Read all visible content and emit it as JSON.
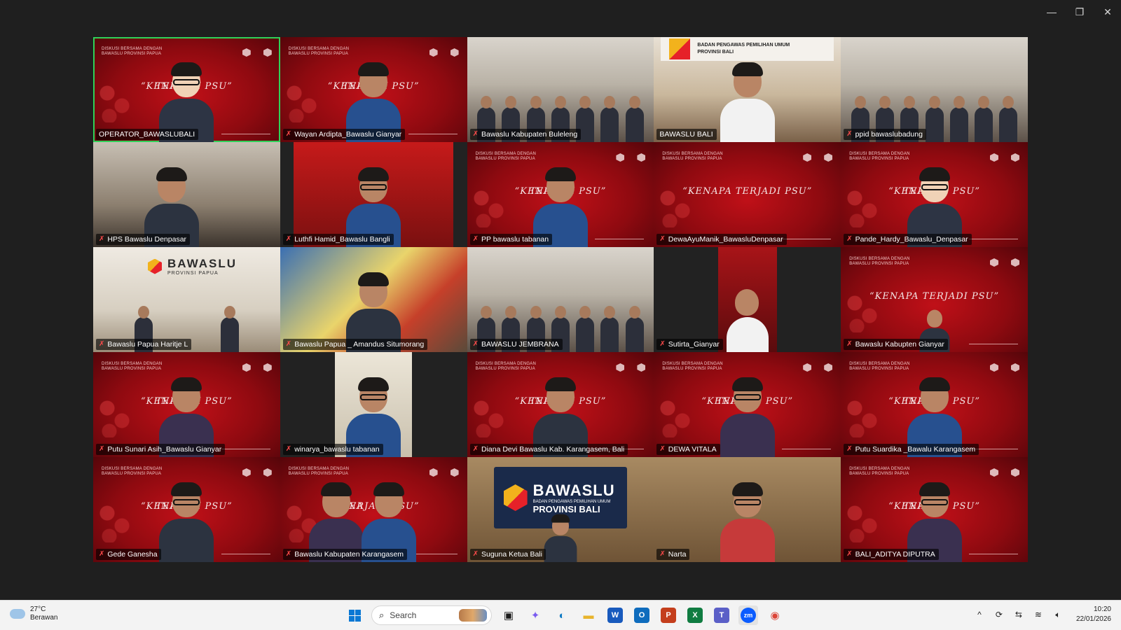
{
  "window": {
    "minimize": "—",
    "restore": "❐",
    "close": "✕"
  },
  "slide": {
    "header": "DISKUSI BERSAMA DENGAN BAWASLU PROVINSI PAPUA",
    "slogan_full": "“KENAPA TERJADI PSU”",
    "slogan_left": "“KENA",
    "slogan_right": "TERJADI PSU”"
  },
  "participants": [
    {
      "name": "OPERATOR_BAWASLUBALI",
      "muted": false,
      "active": true,
      "scene": "avatar"
    },
    {
      "name": "Wayan Ardipta_Bawaslu Gianyar",
      "muted": true,
      "scene": "red-person"
    },
    {
      "name": "Bawaslu Kabupaten Buleleng",
      "muted": true,
      "scene": "room"
    },
    {
      "name": "BAWASLU BALI",
      "muted": false,
      "scene": "bali-office"
    },
    {
      "name": "ppid bawaslubadung",
      "muted": true,
      "scene": "room"
    },
    {
      "name": "HPS Bawaslu Denpasar",
      "muted": true,
      "scene": "office"
    },
    {
      "name": "Luthfi Hamid_Bawaslu Bangli",
      "muted": true,
      "scene": "window"
    },
    {
      "name": "PP bawaslu tabanan",
      "muted": true,
      "scene": "red-person"
    },
    {
      "name": "DewaAyuManik_BawasluDenpasar",
      "muted": true,
      "scene": "red-full"
    },
    {
      "name": "Pande_Hardy_Bawaslu_Denpasar",
      "muted": true,
      "scene": "avatar"
    },
    {
      "name": "Bawaslu Papua Haritje L",
      "muted": true,
      "scene": "papua-wall"
    },
    {
      "name": "Bawaslu Papua _ Amandus Situmorang",
      "muted": true,
      "scene": "map"
    },
    {
      "name": "BAWASLU JEMBRANA",
      "muted": true,
      "scene": "room"
    },
    {
      "name": "Sutirta_Gianyar",
      "muted": true,
      "scene": "narrow"
    },
    {
      "name": "Bawaslu Kabupten Gianyar",
      "muted": true,
      "scene": "red-small"
    },
    {
      "name": "Putu Sunari Asih_Bawaslu Gianyar",
      "muted": true,
      "scene": "red-person"
    },
    {
      "name": "winarya_bawaslu tabanan",
      "muted": true,
      "scene": "narrow-wall"
    },
    {
      "name": "Diana Devi Bawaslu Kab. Karangasem, Bali",
      "muted": true,
      "scene": "red-person"
    },
    {
      "name": "DEWA VITALA",
      "muted": true,
      "scene": "red-person"
    },
    {
      "name": "Putu Suardika _Bawalu Karangasem",
      "muted": true,
      "scene": "red-person"
    },
    {
      "name": "Gede Ganesha",
      "muted": true,
      "scene": "red-person"
    },
    {
      "name": "Bawaslu Kabupaten Karangasem",
      "muted": true,
      "scene": "red-two"
    },
    {
      "name": "Suguna Ketua Bali",
      "muted": true,
      "scene": "brand"
    },
    {
      "name": "Narta",
      "muted": true,
      "scene": "wood"
    },
    {
      "name": "BALI_ADITYA DIPUTRA",
      "muted": true,
      "scene": "red-person"
    }
  ],
  "branding": {
    "papua_main": "BAWASLU",
    "papua_sub": "PROVINSI PAPUA",
    "bali_main": "BAWASLU",
    "bali_sub": "BADAN PENGAWAS PEMILIHAN UMUM",
    "bali_sub2": "PROVINSI BALI",
    "banner_line1": "BADAN PENGAWAS PEMILIHAN UMUM",
    "banner_line2": "PROVINSI BALI"
  },
  "taskbar": {
    "temperature": "27°C",
    "weather": "Berawan",
    "search_placeholder": "Search",
    "time": "10:20",
    "date": "22/01/2026",
    "tray_chevron": "^",
    "apps": [
      {
        "name": "Word",
        "letter": "W",
        "color": "#185abd"
      },
      {
        "name": "Outlook",
        "letter": "O",
        "color": "#0f6cbd"
      },
      {
        "name": "PowerPoint",
        "letter": "P",
        "color": "#c43e1c"
      },
      {
        "name": "Excel",
        "letter": "X",
        "color": "#107c41"
      },
      {
        "name": "Teams",
        "letter": "T",
        "color": "#5b5fc7"
      },
      {
        "name": "Zoom",
        "letter": "zm",
        "color": "#0b5cff"
      }
    ]
  },
  "colors": {
    "active_border": "#30d158",
    "slide_red": "#b50d14",
    "taskbar_bg": "#f3f3f3"
  }
}
